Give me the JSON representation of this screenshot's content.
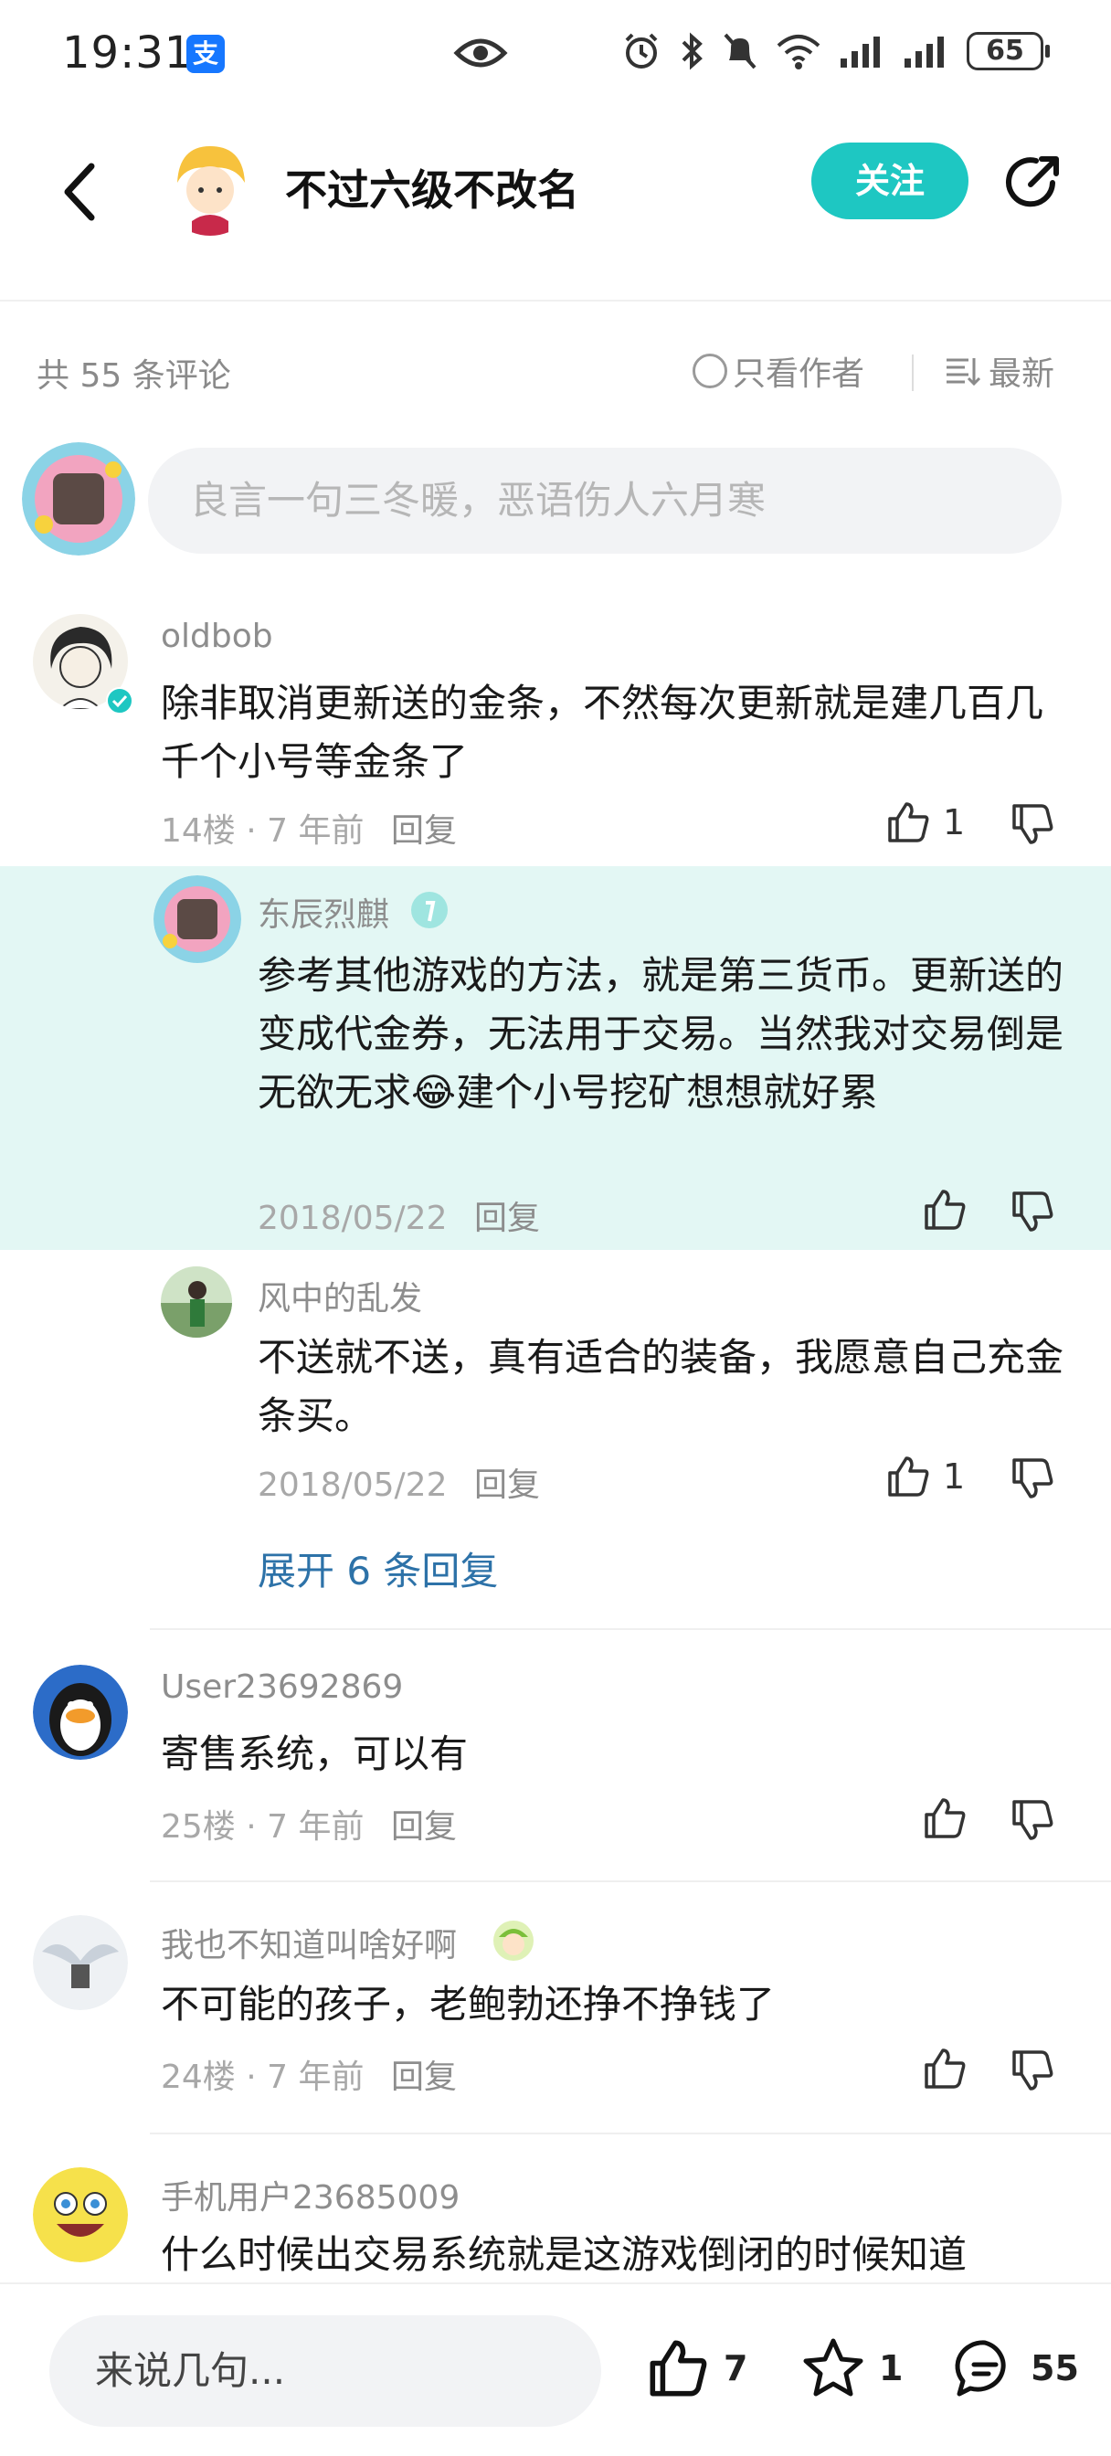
{
  "status_bar": {
    "time": "19:31",
    "alipay_badge": "支",
    "battery": "65"
  },
  "header": {
    "author_name": "不过六级不改名",
    "follow_label": "关注"
  },
  "comment_bar": {
    "count_text": "共 55 条评论",
    "author_only_label": "只看作者",
    "sort_label": "最新"
  },
  "input": {
    "placeholder": "良言一句三冬暖，恶语伤人六月寒"
  },
  "comments": [
    {
      "user": "oldbob",
      "text": "除非取消更新送的金条，不然每次更新就是建几百几千个小号等金条了",
      "floor": "14楼",
      "time": "7 年前",
      "reply": "回复",
      "likes": "1",
      "replies": [
        {
          "user": "东辰烈麒",
          "text": "参考其他游戏的方法，就是第三货币。更新送的变成代金券，无法用于交易。当然我对交易倒是无欲无求😂建个小号挖矿想想就好累",
          "date": "2018/05/22",
          "reply": "回复",
          "likes": ""
        },
        {
          "user": "风中的乱发",
          "text": "不送就不送，真有适合的装备，我愿意自己充金条买。",
          "date": "2018/05/22",
          "reply": "回复",
          "likes": "1"
        }
      ],
      "expand_label": "展开 6 条回复"
    },
    {
      "user": "User23692869",
      "text": "寄售系统，可以有",
      "floor": "25楼",
      "time": "7 年前",
      "reply": "回复"
    },
    {
      "user": "我也不知道叫啥好啊",
      "text": "不可能的孩子，老鲍勃还挣不挣钱了",
      "floor": "24楼",
      "time": "7 年前",
      "reply": "回复"
    },
    {
      "user": "手机用户23685009",
      "text": "什么时候出交易系统就是这游戏倒闭的时候知道"
    }
  ],
  "bottom_bar": {
    "input_placeholder": "来说几句...",
    "like_count": "7",
    "star_count": "1",
    "comment_count": "55"
  },
  "colors": {
    "accent": "#1ec7c2",
    "highlight_bg": "#e3f7f4",
    "link": "#2d72a8"
  }
}
